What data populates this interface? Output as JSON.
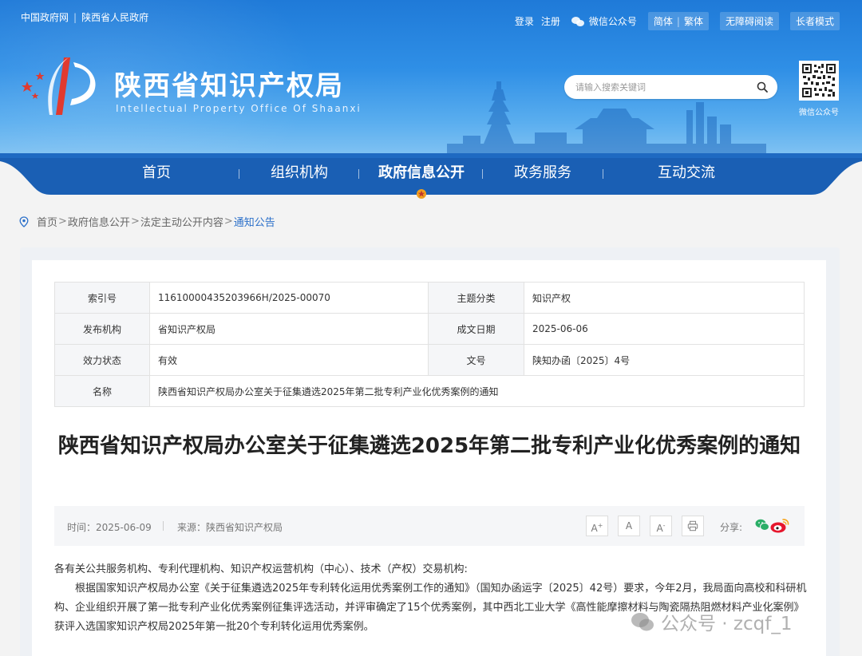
{
  "gov_links": {
    "link1": "中国政府网",
    "link2": "陕西省人民政府"
  },
  "utility": {
    "login": "登录",
    "register": "注册",
    "wechat": "微信公众号",
    "simplified": "简体",
    "traditional": "繁体",
    "accessible": "无障碍阅读",
    "elderly": "长者模式"
  },
  "site": {
    "title": "陕西省知识产权局",
    "subtitle": "Intellectual Property Office Of Shaanxi"
  },
  "search": {
    "placeholder": "请输入搜索关键词"
  },
  "qr_label": "微信公众号",
  "nav": {
    "items": [
      "首页",
      "组织机构",
      "政府信息公开",
      "政务服务",
      "互动交流"
    ],
    "active": "政府信息公开"
  },
  "breadcrumb": {
    "home": "首页",
    "level1": "政府信息公开",
    "level2": "法定主动公开内容",
    "current": "通知公告"
  },
  "meta": {
    "index_label": "索引号",
    "index_value": "11610000435203966H/2025-00070",
    "topic_label": "主题分类",
    "topic_value": "知识产权",
    "publisher_label": "发布机构",
    "publisher_value": "省知识产权局",
    "date_label": "成文日期",
    "date_value": "2025-06-06",
    "status_label": "效力状态",
    "status_value": "有效",
    "docno_label": "文号",
    "docno_value": "陕知办函〔2025〕4号",
    "name_label": "名称",
    "name_value": "陕西省知识产权局办公室关于征集遴选2025年第二批专利产业化优秀案例的通知"
  },
  "article": {
    "title": "陕西省知识产权局办公室关于征集遴选2025年第二批专利产业化优秀案例的通知",
    "time": "时间：2025-06-09",
    "source": "来源：陕西省知识产权局",
    "font_large": "A",
    "font_normal": "A",
    "font_small": "A",
    "font_large_sup": "+",
    "font_small_sup": "-",
    "share": "分享:",
    "salutation": "各有关公共服务机构、专利代理机构、知识产权运营机构（中心）、技术（产权）交易机构:",
    "para1": "根据国家知识产权局办公室《关于征集遴选2025年专利转化运用优秀案例工作的通知》（国知办函运字〔2025〕42号）要求，今年2月，我局面向高校和科研机构、企业组织开展了第一批专利产业化优秀案例征集评选活动，并评审确定了15个优秀案例，其中西北工业大学《高性能摩擦材料与陶瓷隔热阻燃材料产业化案例》获评入选国家知识产权局2025年第一批20个专利转化运用优秀案例。"
  },
  "watermark": "公众号 · zcqf_1",
  "colors": {
    "header_blue": "#2f8fe6",
    "nav_blue": "#1a5fb4",
    "link_blue": "#2a6fc9",
    "weibo_red": "#e6162d",
    "wechat_green": "#2aae67"
  }
}
